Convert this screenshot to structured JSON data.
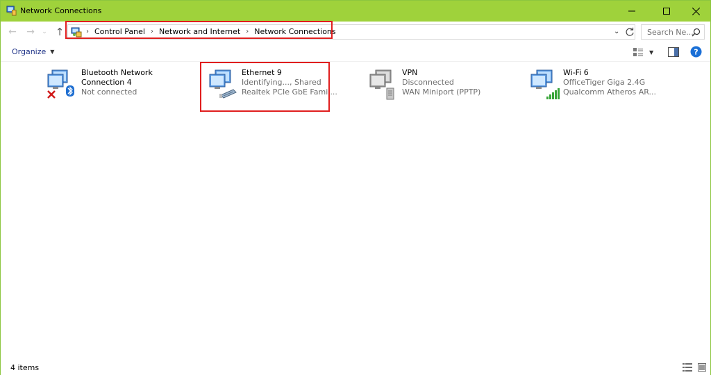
{
  "window": {
    "title": "Network Connections"
  },
  "address": {
    "crumbs": [
      "Control Panel",
      "Network and Internet",
      "Network Connections"
    ],
    "search_placeholder": "Search Ne..."
  },
  "toolbar": {
    "organize_label": "Organize"
  },
  "connections": [
    {
      "name_line1": "Bluetooth Network",
      "name_line2": "Connection 4",
      "status": "Not connected",
      "device": "",
      "icon": "bluetooth-network-icon"
    },
    {
      "name_line1": "Ethernet 9",
      "name_line2": "",
      "status": "Identifying..., Shared",
      "device": "Realtek PCIe GbE Famil...",
      "icon": "ethernet-network-icon"
    },
    {
      "name_line1": "VPN",
      "name_line2": "",
      "status": "Disconnected",
      "device": "WAN Miniport (PPTP)",
      "icon": "vpn-network-icon"
    },
    {
      "name_line1": "Wi-Fi 6",
      "name_line2": "",
      "status": "OfficeTiger Giga 2.4G",
      "device": "Qualcomm Atheros AR...",
      "icon": "wifi-network-icon"
    }
  ],
  "status": {
    "item_count": "4 items"
  },
  "colors": {
    "title_bar": "#9fd23b",
    "highlight": "#e01e1e",
    "link_blue": "#1e3287",
    "help_blue": "#1a6fd6"
  }
}
